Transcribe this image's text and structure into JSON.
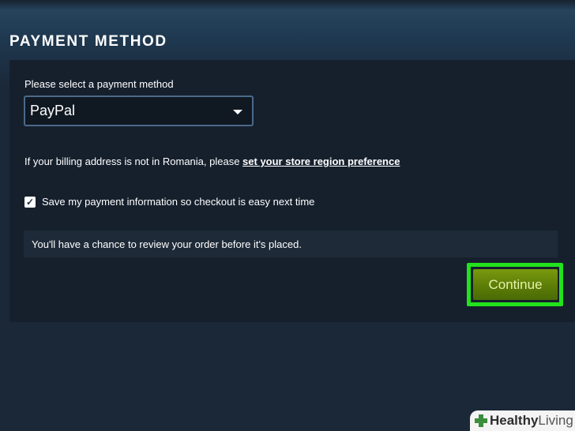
{
  "section": {
    "title": "PAYMENT METHOD"
  },
  "payment": {
    "select_label": "Please select a payment method",
    "selected_method": "PayPal"
  },
  "billing": {
    "note_text": "If your billing address is not in Romania, please ",
    "link_text": "set your store region preference"
  },
  "save_info": {
    "checked": true,
    "label": "Save my payment information so checkout is easy next time"
  },
  "review": {
    "text": "You'll have a chance to review your order before it's placed."
  },
  "actions": {
    "continue_label": "Continue"
  },
  "watermark": {
    "brand_bold": "Healthy",
    "brand_light": "Living"
  },
  "colors": {
    "background": "#1b2838",
    "panel": "#16202d",
    "continue_button": "#5c7d07",
    "highlight": "#22e31b"
  },
  "icons": {
    "select_arrow": "chevron-down-icon",
    "checkbox_mark": "checkmark-icon",
    "watermark_logo": "cross-icon"
  }
}
